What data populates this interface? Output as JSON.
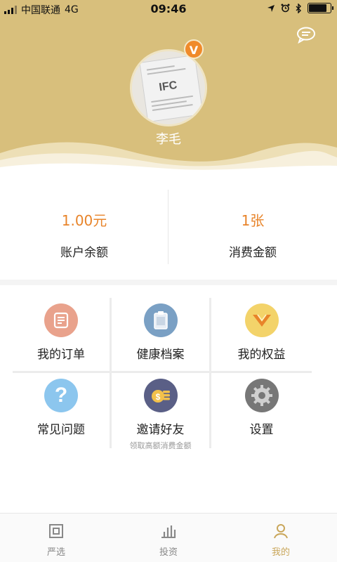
{
  "status_bar": {
    "carrier": "中国联通",
    "network": "4G",
    "time": "09:46",
    "battery_level": 0.85
  },
  "header": {
    "username": "李毛",
    "vip_badge": "V",
    "avatar_card_logo": "IFC",
    "background_color": "#d8bf7c"
  },
  "stats": [
    {
      "value": "1.00元",
      "label": "账户余额"
    },
    {
      "value": "1张",
      "label": "消费金额"
    }
  ],
  "menu": [
    {
      "label": "我的订单",
      "icon": "order-icon",
      "color": "#e9a28c"
    },
    {
      "label": "健康档案",
      "icon": "clipboard-icon",
      "color": "#7aa0c4"
    },
    {
      "label": "我的权益",
      "icon": "vip-icon",
      "color": "#f3d36a"
    },
    {
      "label": "常见问题",
      "icon": "question-icon",
      "color": "#8cc6ee"
    },
    {
      "label": "邀请好友",
      "icon": "coins-icon",
      "color": "#5a5f86",
      "sub": "领取高额消费金额"
    },
    {
      "label": "设置",
      "icon": "gear-icon",
      "color": "#777777"
    }
  ],
  "tabbar": [
    {
      "label": "严选",
      "icon": "square-icon",
      "active": false
    },
    {
      "label": "投资",
      "icon": "bar-chart-icon",
      "active": false
    },
    {
      "label": "我的",
      "icon": "person-icon",
      "active": true
    }
  ],
  "accent_color": "#e8842a"
}
